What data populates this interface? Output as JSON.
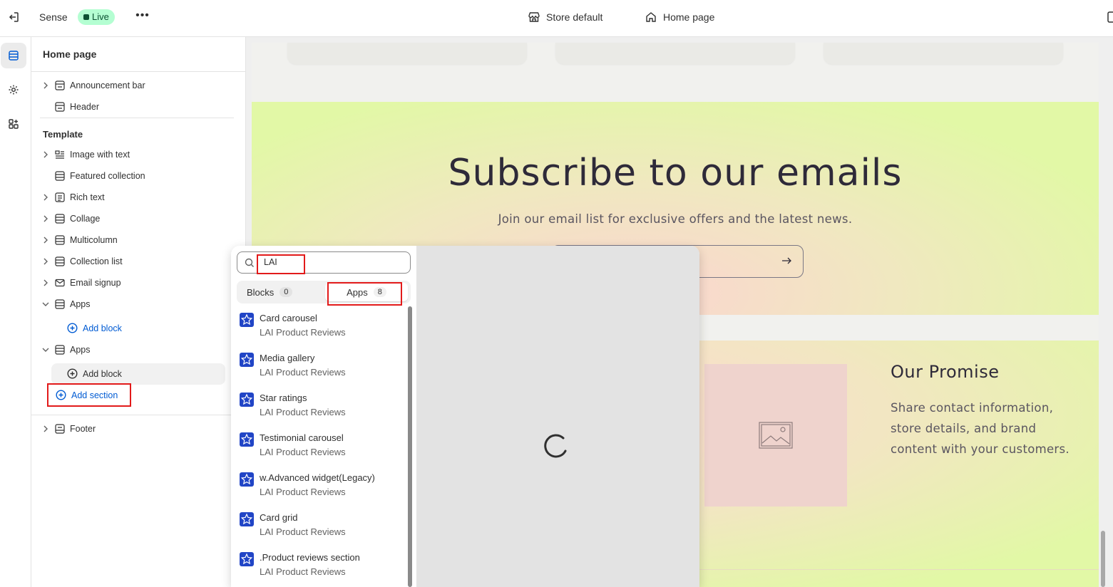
{
  "topbar": {
    "theme_name": "Sense",
    "status_badge": "Live",
    "more_label": "•••",
    "store_label": "Store default",
    "page_label": "Home page"
  },
  "sidebar": {
    "title": "Home page",
    "header_group": [
      {
        "label": "Announcement bar",
        "icon": "section-icon",
        "expandable": true
      },
      {
        "label": "Header",
        "icon": "section-icon",
        "expandable": false
      }
    ],
    "template_label": "Template",
    "template_items": [
      {
        "label": "Image with text",
        "icon": "image-text-icon",
        "expandable": true
      },
      {
        "label": "Featured collection",
        "icon": "section-icon",
        "expandable": false
      },
      {
        "label": "Rich text",
        "icon": "text-icon",
        "expandable": true
      },
      {
        "label": "Collage",
        "icon": "section-icon",
        "expandable": true
      },
      {
        "label": "Multicolumn",
        "icon": "section-icon",
        "expandable": true
      },
      {
        "label": "Collection list",
        "icon": "section-icon",
        "expandable": true
      },
      {
        "label": "Email signup",
        "icon": "email-icon",
        "expandable": true
      },
      {
        "label": "Apps",
        "icon": "section-icon",
        "expanded": true
      },
      {
        "label": "Apps",
        "icon": "section-icon",
        "expanded": true
      }
    ],
    "add_block_label": "Add block",
    "add_section_label": "Add section",
    "footer_label": "Footer"
  },
  "preview": {
    "subscribe_title": "Subscribe to our emails",
    "subscribe_text": "Join our email list for exclusive offers and the latest news.",
    "promise_title": "Our Promise",
    "promise_text": "Share contact information, store details, and brand content with your customers."
  },
  "popover": {
    "search_value": "LAI",
    "tabs": [
      {
        "label": "Blocks",
        "count": "0",
        "active": false
      },
      {
        "label": "Apps",
        "count": "8",
        "active": true
      }
    ],
    "apps": [
      {
        "name": "Card carousel",
        "vendor": "LAI Product Reviews"
      },
      {
        "name": "Media gallery",
        "vendor": "LAI Product Reviews"
      },
      {
        "name": "Star ratings",
        "vendor": "LAI Product Reviews"
      },
      {
        "name": "Testimonial carousel",
        "vendor": "LAI Product Reviews"
      },
      {
        "name": "w.Advanced widget(Legacy)",
        "vendor": "LAI Product Reviews"
      },
      {
        "name": "Card grid",
        "vendor": "LAI Product Reviews"
      },
      {
        "name": ".Product reviews section",
        "vendor": "LAI Product Reviews"
      }
    ]
  },
  "colors": {
    "accent": "#005bd3",
    "live_badge": "#b4fed2",
    "highlight_box": "#e21a1a",
    "app_icon": "#2145c6"
  }
}
